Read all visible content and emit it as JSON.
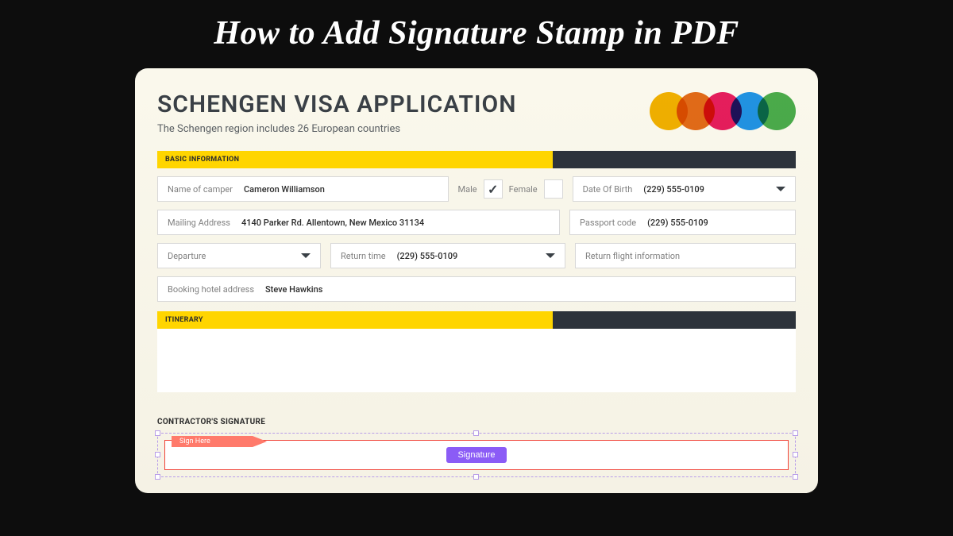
{
  "page_title": "How to Add Signature Stamp in PDF",
  "form": {
    "title": "SCHENGEN VISA APPLICATION",
    "subtitle": "The Schengen region includes 26 European countries",
    "sections": {
      "basic_info": {
        "header": "BASIC INFORMATION",
        "name_label": "Name of camper",
        "name_value": "Cameron Williamson",
        "gender_male_label": "Male",
        "gender_female_label": "Female",
        "dob_label": "Date Of Birth",
        "dob_value": "(229) 555-0109",
        "mailing_label": "Mailing Address",
        "mailing_value": "4140 Parker Rd. Allentown, New Mexico 31134",
        "passport_label": "Passport code",
        "passport_value": "(229) 555-0109",
        "departure_label": "Departure",
        "return_time_label": "Return time",
        "return_time_value": "(229) 555-0109",
        "return_flight_label": "Return flight information",
        "booking_label": "Booking hotel address",
        "booking_value": "Steve Hawkins"
      },
      "itinerary": {
        "header": "ITINERARY"
      },
      "signature": {
        "header": "CONTRACTOR'S SIGNATURE",
        "sign_here": "Sign Here",
        "button": "Signature"
      }
    }
  }
}
